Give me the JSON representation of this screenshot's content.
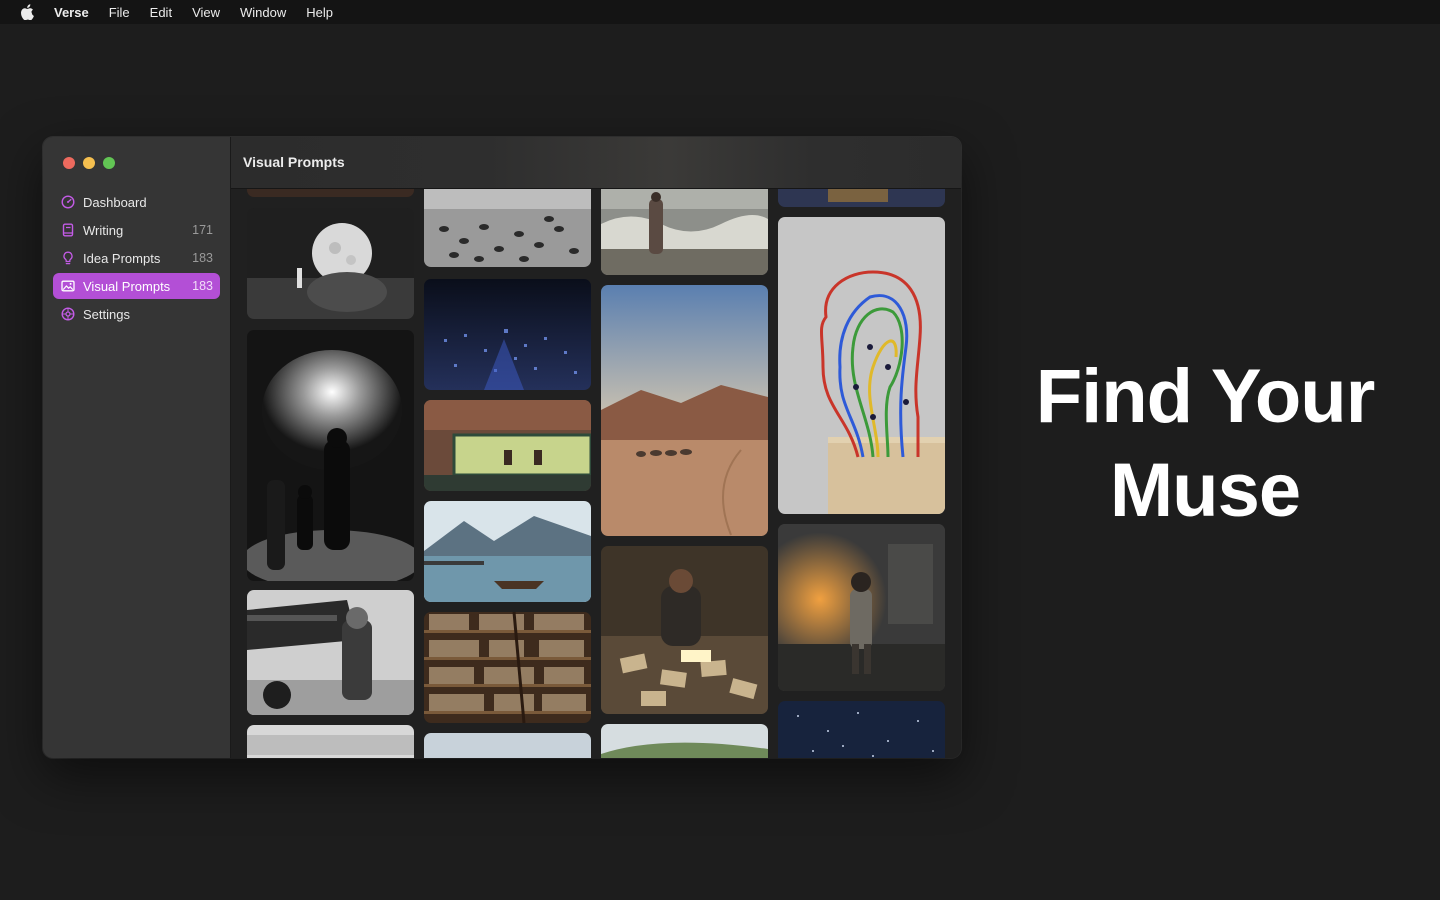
{
  "menubar": {
    "apple_icon": "apple-logo-icon",
    "app_name": "Verse",
    "items": [
      "File",
      "Edit",
      "View",
      "Window",
      "Help"
    ]
  },
  "window": {
    "title": "Visual Prompts",
    "sidebar": {
      "items": [
        {
          "label": "Dashboard",
          "count": "",
          "icon": "gauge-icon"
        },
        {
          "label": "Writing",
          "count": "171",
          "icon": "book-icon"
        },
        {
          "label": "Idea Prompts",
          "count": "183",
          "icon": "lightbulb-icon"
        },
        {
          "label": "Visual Prompts",
          "count": "183",
          "icon": "photo-icon",
          "active": true
        },
        {
          "label": "Settings",
          "count": "",
          "icon": "gear-icon"
        }
      ]
    },
    "gallery": {
      "tiles": [
        {
          "subject": "moon-child-boulder"
        },
        {
          "subject": "fireworks-family-silhouette"
        },
        {
          "subject": "aviator-biplane"
        },
        {
          "subject": "pigeons-square"
        },
        {
          "subject": "city-night-lights"
        },
        {
          "subject": "diner-nighthawks"
        },
        {
          "subject": "fjord-boat"
        },
        {
          "subject": "library-ladder"
        },
        {
          "subject": "woman-stormy-sea"
        },
        {
          "subject": "desert-camels"
        },
        {
          "subject": "boy-letters-floor"
        },
        {
          "subject": "wire-head-sculpture"
        },
        {
          "subject": "child-burning-ruins"
        },
        {
          "subject": "starry-sky"
        }
      ]
    }
  },
  "tagline": {
    "line1": "Find Your",
    "line2": "Muse"
  },
  "colors": {
    "accent": "#b34fd6",
    "background": "#1d1d1d",
    "sidebar": "#353535"
  }
}
